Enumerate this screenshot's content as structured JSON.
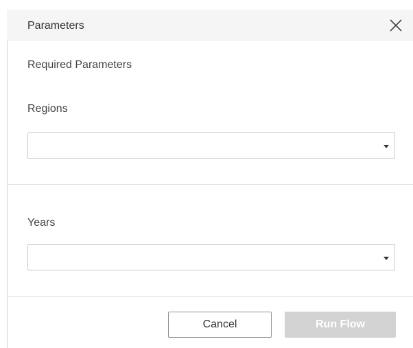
{
  "dialog": {
    "title": "Parameters",
    "close_icon": "close-icon",
    "required_heading": "Required Parameters",
    "parameters": [
      {
        "label": "Regions",
        "selected_value": ""
      },
      {
        "label": "Years",
        "selected_value": ""
      }
    ],
    "buttons": {
      "cancel_label": "Cancel",
      "run_label": "Run Flow"
    }
  },
  "colors": {
    "title_bar_bg": "#f5f5f5",
    "disabled_button_bg": "#d3d3d3",
    "border": "#c8c8c8"
  }
}
